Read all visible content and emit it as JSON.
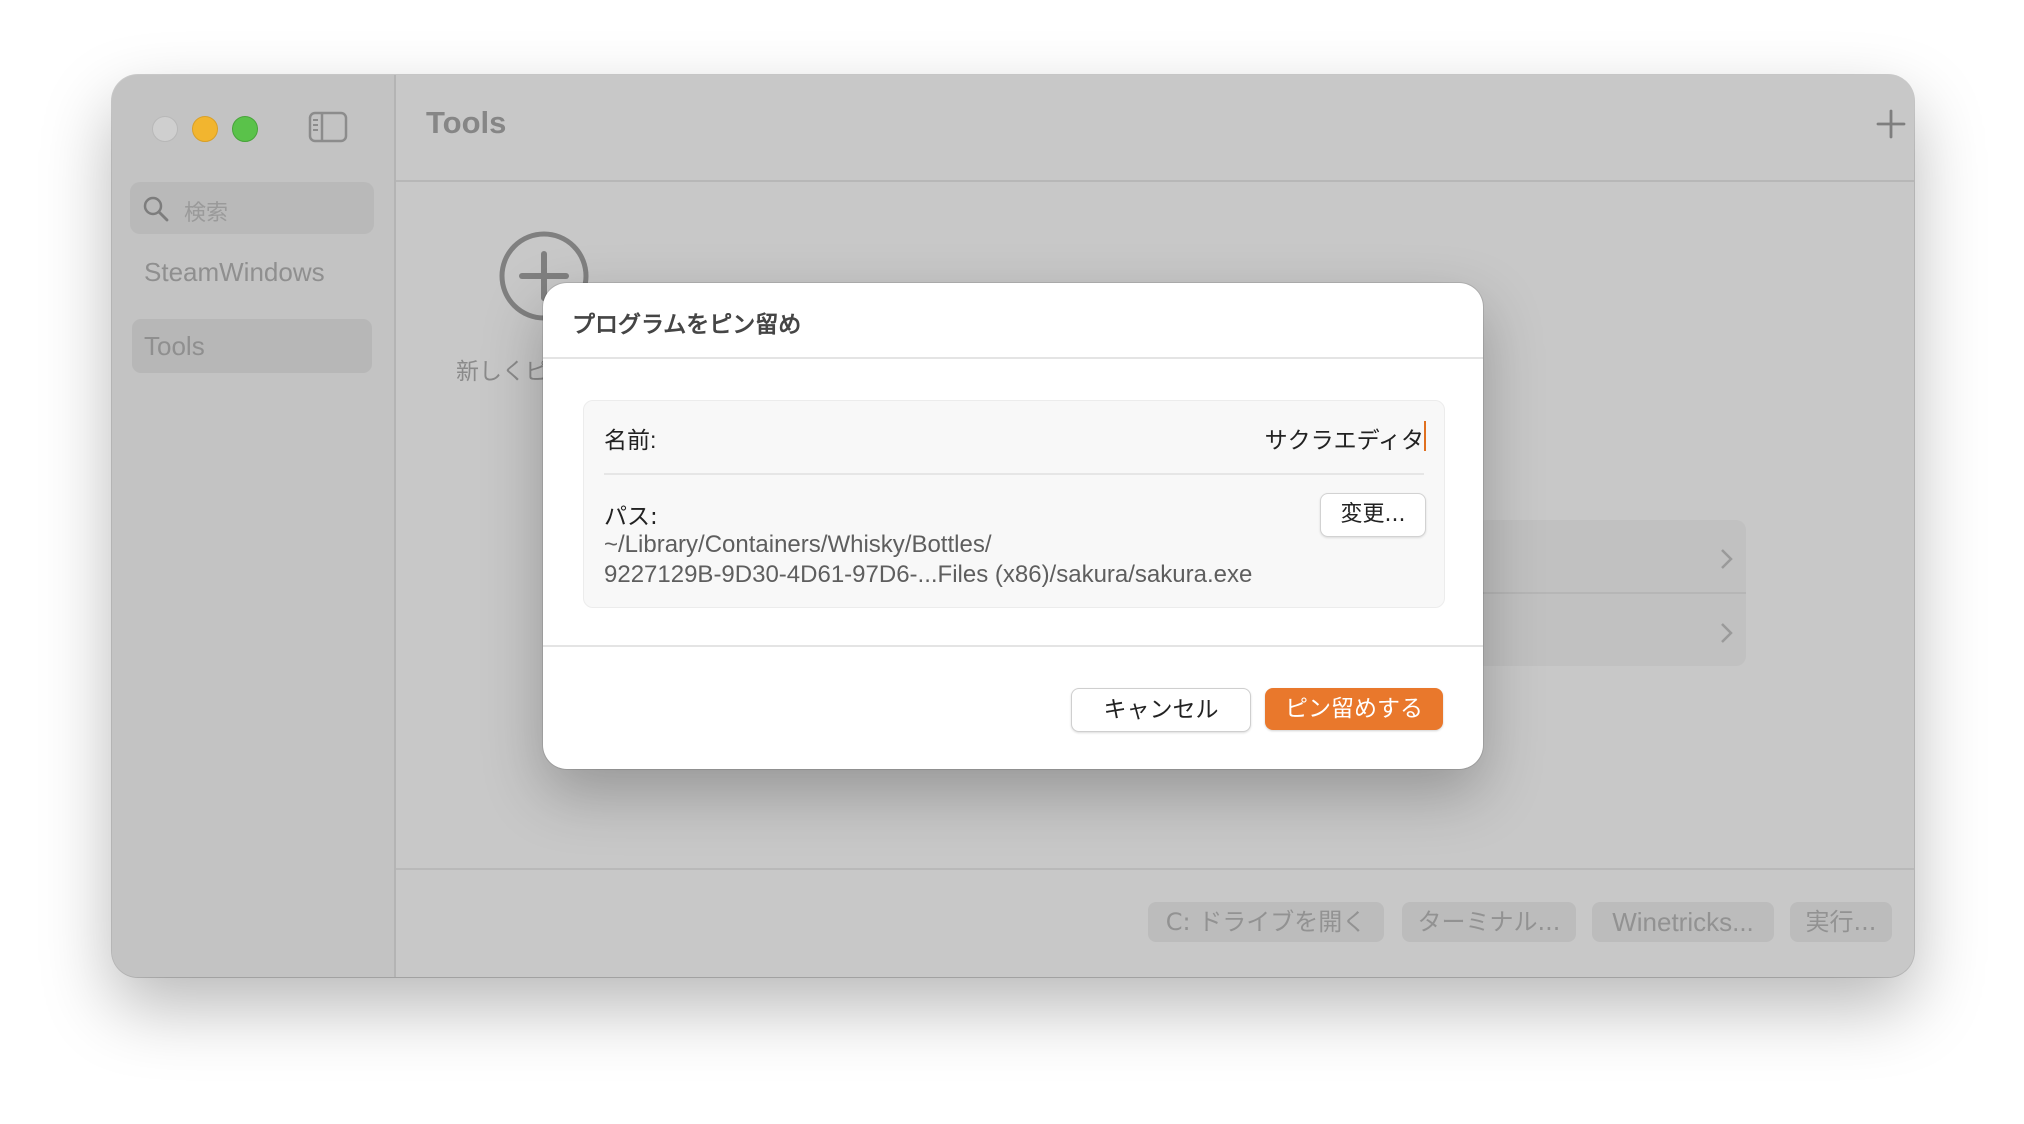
{
  "colors": {
    "accent": "#e9782c",
    "traffic_close": "#cfcfcf",
    "traffic_minimize": "#f2b52f",
    "traffic_maximize": "#5ac24a"
  },
  "sidebar": {
    "search": {
      "placeholder": "検索",
      "icon": "search-icon"
    },
    "items": [
      {
        "label": "SteamWindows",
        "selected": false
      },
      {
        "label": "Tools",
        "selected": true
      }
    ]
  },
  "toolbar": {
    "title": "Tools",
    "icons": [
      "plus-icon",
      "sync-icon"
    ]
  },
  "content": {
    "add_program_label": "新しくピ"
  },
  "bottom_bar": {
    "open_c_drive": "C: ドライブを開く",
    "terminal": "ターミナル...",
    "winetricks": "Winetricks...",
    "run": "実行..."
  },
  "dialog": {
    "title": "プログラムをピン留め",
    "name_label": "名前:",
    "name_value": "サクラエディタ",
    "path_label": "パス:",
    "path_line1": "~/Library/Containers/Whisky/Bottles/",
    "path_line2": "9227129B-9D30-4D61-97D6-...Files (x86)/sakura/sakura.exe",
    "change_button": "変更...",
    "cancel_button": "キャンセル",
    "pin_button": "ピン留めする"
  }
}
